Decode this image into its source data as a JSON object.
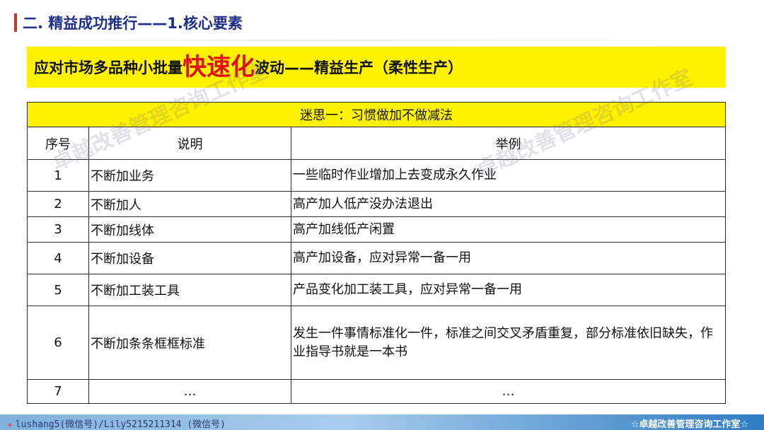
{
  "header": {
    "title": "二. 精益成功推行——1.核心要素"
  },
  "headline": {
    "prefix": "应对市场多品种小批量",
    "emphasis": "快速化",
    "suffix": "波动——精益生产（柔性生产）"
  },
  "watermark": {
    "text_1": "卓越改善管理咨询工作室",
    "text_2": "卓越改善管理咨询工作室"
  },
  "table": {
    "myth_title": "迷思一：习惯做加不做减法",
    "columns": [
      "序号",
      "说明",
      "举例"
    ],
    "rows": [
      {
        "num": "1",
        "desc": "不断加业务",
        "example": "一些临时作业增加上去变成永久作业"
      },
      {
        "num": "2",
        "desc": "不断加人",
        "example": "高产加人低产没办法退出"
      },
      {
        "num": "3",
        "desc": "不断加线体",
        "example": "高产加线低产闲置"
      },
      {
        "num": "4",
        "desc": "不断加设备",
        "example": "高产加设备，应对异常一备一用"
      },
      {
        "num": "5",
        "desc": "不断加工装工具",
        "example": "产品变化加工装工具，应对异常一备一用"
      },
      {
        "num": "6",
        "desc": "不断加条条框框标准",
        "example": "发生一件事情标准化一件，标准之间交叉矛盾重复，部分标准依旧缺失，作业指导书就是一本书"
      },
      {
        "num": "7",
        "desc": "…",
        "example": "…"
      }
    ]
  },
  "footer": {
    "left": "lushang5(微信号)/Lily5215211314 (微信号)",
    "right": "☆卓越改善管理咨询工作室☆"
  },
  "colors": {
    "title_blue": "#1f2f8c",
    "highlight_yellow": "#fff200",
    "emphasis_red": "#e01010",
    "footer_blue": "#2e7cc4"
  }
}
